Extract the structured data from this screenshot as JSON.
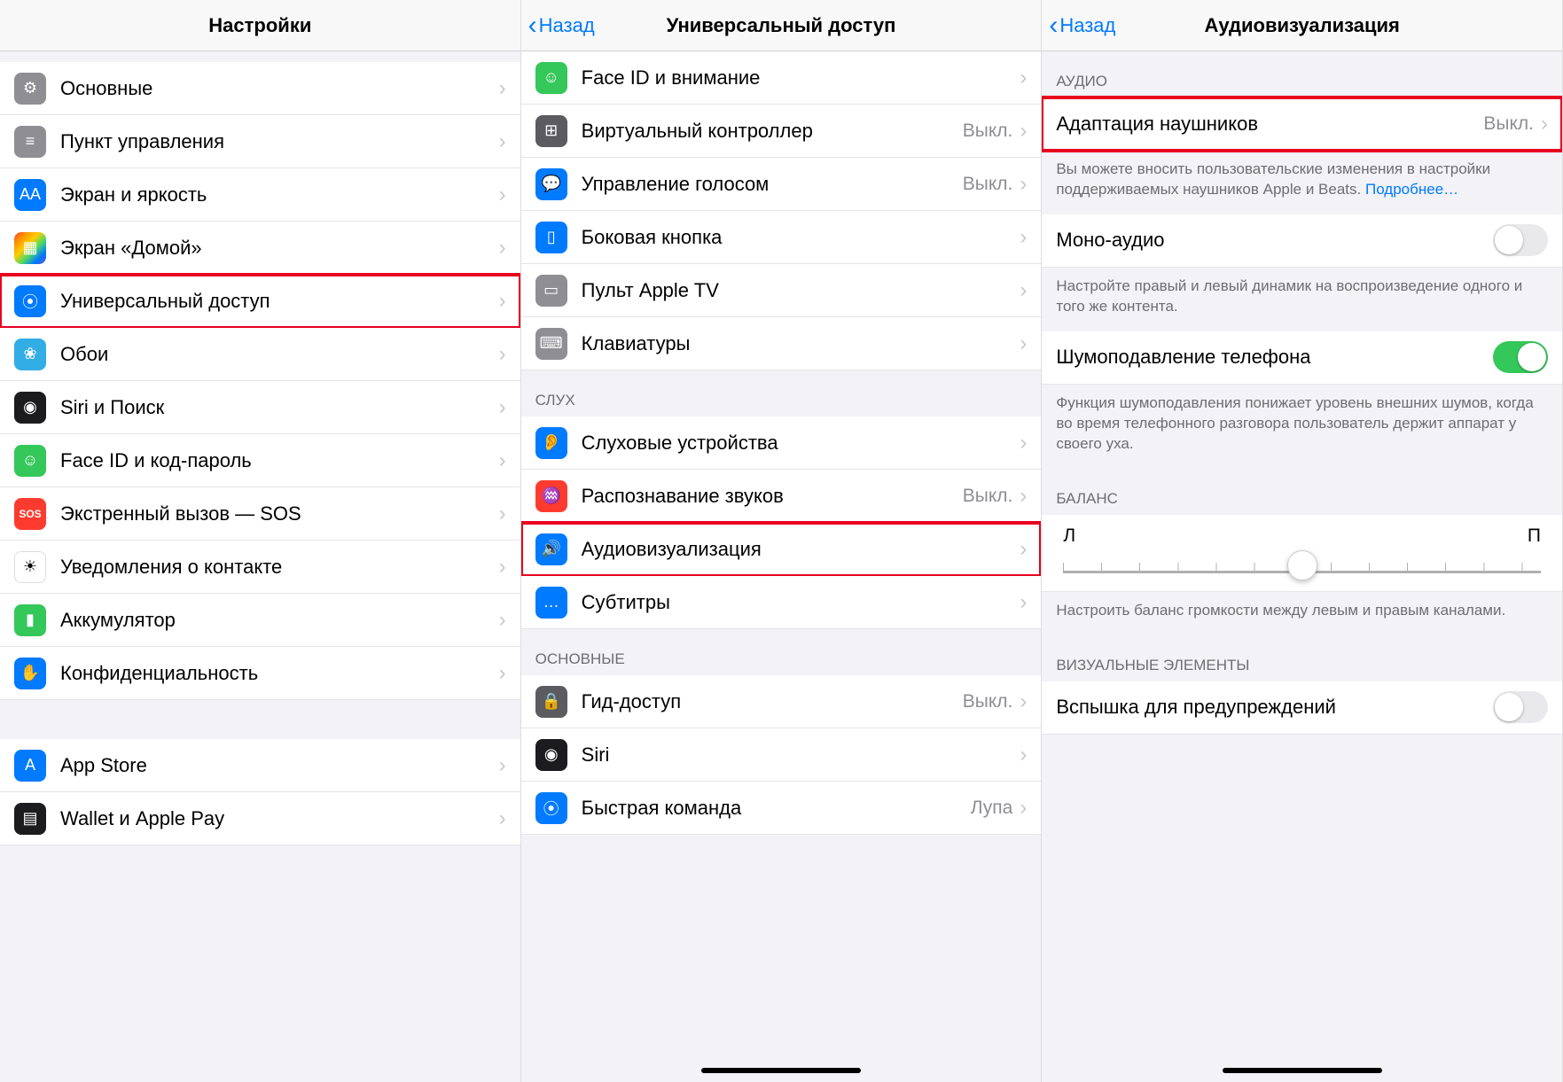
{
  "screen1": {
    "title": "Настройки",
    "items": [
      {
        "label": "Основные",
        "icon": "gear-icon",
        "bg": "bg-gray"
      },
      {
        "label": "Пункт управления",
        "icon": "sliders-icon",
        "bg": "bg-gray"
      },
      {
        "label": "Экран и яркость",
        "icon": "text-size-icon",
        "bg": "bg-blue"
      },
      {
        "label": "Экран «Домой»",
        "icon": "home-grid-icon",
        "bg": "bg-multi"
      },
      {
        "label": "Универсальный доступ",
        "icon": "accessibility-icon",
        "bg": "bg-blue",
        "highlight": true
      },
      {
        "label": "Обои",
        "icon": "flower-icon",
        "bg": "bg-cyan"
      },
      {
        "label": "Siri и Поиск",
        "icon": "siri-icon",
        "bg": "bg-black"
      },
      {
        "label": "Face ID и код-пароль",
        "icon": "faceid-icon",
        "bg": "bg-green"
      },
      {
        "label": "Экстренный вызов — SOS",
        "icon": "sos-icon",
        "bg": "bg-red"
      },
      {
        "label": "Уведомления о контакте",
        "icon": "exposure-icon",
        "bg": "bg-white"
      },
      {
        "label": "Аккумулятор",
        "icon": "battery-icon",
        "bg": "bg-green"
      },
      {
        "label": "Конфиденциальность",
        "icon": "hand-icon",
        "bg": "bg-blue"
      }
    ],
    "items2": [
      {
        "label": "App Store",
        "icon": "appstore-icon",
        "bg": "bg-blue"
      },
      {
        "label": "Wallet и Apple Pay",
        "icon": "wallet-icon",
        "bg": "bg-black"
      }
    ]
  },
  "screen2": {
    "back": "Назад",
    "title": "Универсальный доступ",
    "group1": [
      {
        "label": "Face ID и внимание",
        "icon": "faceid-icon",
        "bg": "bg-green"
      },
      {
        "label": "Виртуальный контроллер",
        "value": "Выкл.",
        "icon": "grid-icon",
        "bg": "bg-darkgray"
      },
      {
        "label": "Управление голосом",
        "value": "Выкл.",
        "icon": "voice-icon",
        "bg": "bg-blue"
      },
      {
        "label": "Боковая кнопка",
        "icon": "side-button-icon",
        "bg": "bg-blue"
      },
      {
        "label": "Пульт Apple TV",
        "icon": "remote-icon",
        "bg": "bg-gray"
      },
      {
        "label": "Клавиатуры",
        "icon": "keyboard-icon",
        "bg": "bg-gray"
      }
    ],
    "header2": "СЛУХ",
    "group2": [
      {
        "label": "Слуховые устройства",
        "icon": "ear-icon",
        "bg": "bg-blue"
      },
      {
        "label": "Распознавание звуков",
        "value": "Выкл.",
        "icon": "sound-recognition-icon",
        "bg": "bg-red"
      },
      {
        "label": "Аудиовизуализация",
        "icon": "audio-visual-icon",
        "bg": "bg-blue",
        "highlight": true
      },
      {
        "label": "Субтитры",
        "icon": "subtitles-icon",
        "bg": "bg-blue"
      }
    ],
    "header3": "ОСНОВНЫЕ",
    "group3": [
      {
        "label": "Гид-доступ",
        "value": "Выкл.",
        "icon": "guided-access-icon",
        "bg": "bg-darkgray"
      },
      {
        "label": "Siri",
        "icon": "siri-icon",
        "bg": "bg-black"
      },
      {
        "label": "Быстрая команда",
        "value": "Лупа",
        "icon": "accessibility-icon",
        "bg": "bg-blue"
      }
    ]
  },
  "screen3": {
    "back": "Назад",
    "title": "Аудиовизуализация",
    "header1": "АУДИО",
    "row1": {
      "label": "Адаптация наушников",
      "value": "Выкл."
    },
    "footer1": "Вы можете вносить пользовательские изменения в настройки поддерживаемых наушников Apple и Beats.",
    "footer1_link": "Подробнее…",
    "row2": {
      "label": "Моно-аудио",
      "on": false
    },
    "footer2": "Настройте правый и левый динамик на воспроизведение одного и того же контента.",
    "row3": {
      "label": "Шумоподавление телефона",
      "on": true
    },
    "footer3": "Функция шумоподавления понижает уровень внешних шумов, когда во время телефонного разговора пользователь держит аппарат у своего уха.",
    "header2": "БАЛАНС",
    "balance": {
      "left": "Л",
      "right": "П"
    },
    "footer4": "Настроить баланс громкости между левым и правым каналами.",
    "header3": "ВИЗУАЛЬНЫЕ ЭЛЕМЕНТЫ",
    "row4": {
      "label": "Вспышка для предупреждений",
      "on": false
    }
  }
}
